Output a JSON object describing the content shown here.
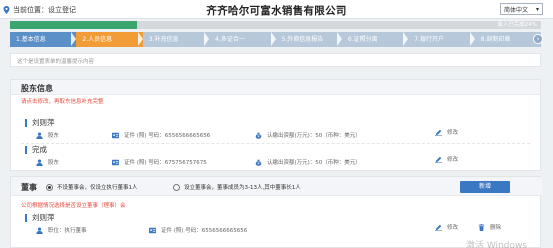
{
  "header": {
    "location": "当前位置：设立登记",
    "company": "齐齐哈尔可富水销售有限公司",
    "language": "简体中文",
    "language_arrow": "▾"
  },
  "progress": {
    "percent": 24,
    "label": "录入已完成24%"
  },
  "steps": [
    {
      "label": "1.基本信息",
      "state": "done"
    },
    {
      "label": "2.人员信息",
      "state": "active"
    },
    {
      "label": "3.补充信息",
      "state": "todo"
    },
    {
      "label": "4.多证合一",
      "state": "todo"
    },
    {
      "label": "5.外商信息报告",
      "state": "todo"
    },
    {
      "label": "6.证照分离",
      "state": "todo"
    },
    {
      "label": "7.银行开户",
      "state": "todo"
    },
    {
      "label": "8.刻制印章",
      "state": "todo"
    }
  ],
  "step_next": "›",
  "tips": "这个是设置表单的温馨提示内容",
  "shareholders": {
    "title": "股东信息",
    "alert": "请点击修改，再取东信息补充完整",
    "items": [
      {
        "name": "刘则萍",
        "role": "股东",
        "cert": "证件 (照) 号码：6556566665656",
        "capital": "认缴出资额(万元)：50（币种：美元）",
        "edit": "修改"
      },
      {
        "name": "完成",
        "role": "股东",
        "cert": "证件 (照) 号码：675756757675",
        "capital": "认缴出资额(万元)：50（币种：美元）",
        "edit": "修改"
      }
    ]
  },
  "directors": {
    "title": "董事",
    "option_a": "不设董事会，仅设立执行董事1人",
    "option_b": "设立董事会，董事成员为3-13人,其中董事长1人",
    "add_label": "新增",
    "alert": "公司根据情况选择是否设立董事（理事）会",
    "member": {
      "name": "刘则萍",
      "position": "职位：执行董事",
      "cert": "证件 (照) 号码：6556566665656",
      "edit": "修改",
      "delete": "删除"
    }
  },
  "watermark": "激活 Windows",
  "colors": {
    "accent": "#3b78c4",
    "step_done": "#5b8fc8",
    "step_active": "#f29c38",
    "progress": "#3aa56e",
    "alert": "#e74c3c"
  }
}
